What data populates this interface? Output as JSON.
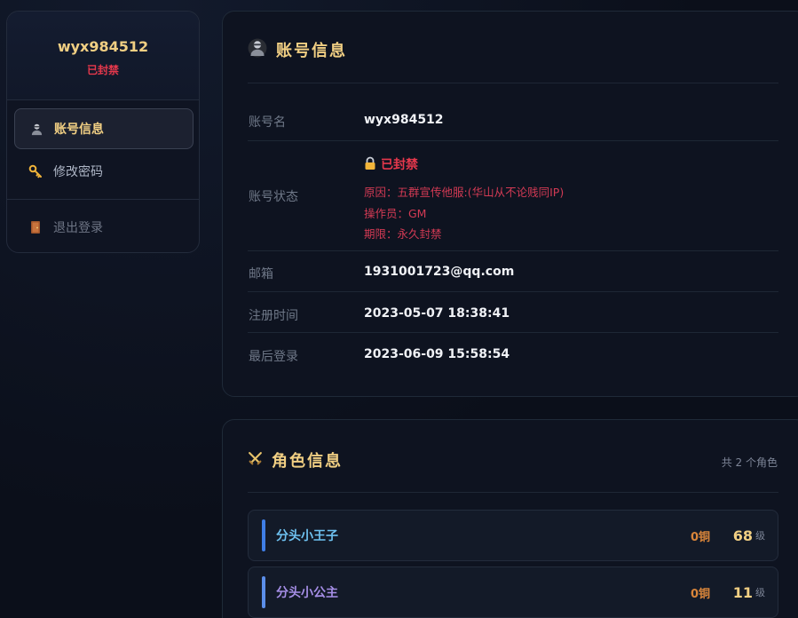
{
  "sidebar": {
    "username": "wyx984512",
    "status": "已封禁",
    "nav": [
      {
        "label": "账号信息",
        "icon": "user-icon"
      },
      {
        "label": "修改密码",
        "icon": "key-icon"
      },
      {
        "label": "退出登录",
        "icon": "door-icon"
      }
    ]
  },
  "account": {
    "title": "账号信息",
    "title_icon": "user-icon",
    "rows": {
      "name_label": "账号名",
      "name_value": "wyx984512",
      "status_label": "账号状态",
      "status_value": "已封禁",
      "ban_reason": "原因：五群宣传他服:(华山从不论贱同IP)",
      "ban_operator": "操作员：GM",
      "ban_duration": "期限：永久封禁",
      "email_label": "邮箱",
      "email_value": "1931001723@qq.com",
      "reg_label": "注册时间",
      "reg_value": "2023-05-07 18:38:41",
      "last_label": "最后登录",
      "last_value": "2023-06-09 15:58:54"
    }
  },
  "roles": {
    "title": "角色信息",
    "title_icon": "crossed-swords-icon",
    "count": "共 2 个角色",
    "items": [
      {
        "name": "分头小王子",
        "money": "0铜",
        "level": "68",
        "unit": "级"
      },
      {
        "name": "分头小公主",
        "money": "0铜",
        "level": "11",
        "unit": "级"
      }
    ]
  },
  "colors": {
    "accent_gold": "#f1cf83",
    "danger": "#e5384c",
    "background": "#0b0f1a"
  }
}
